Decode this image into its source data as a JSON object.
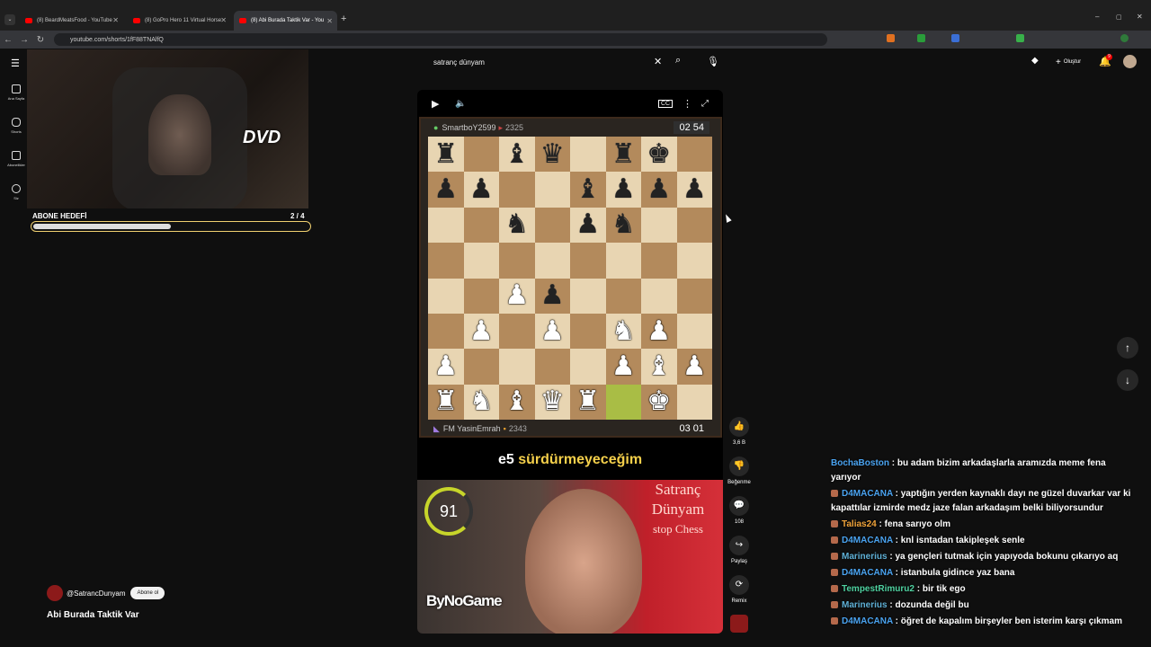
{
  "browser": {
    "tabs": [
      {
        "title": "(8) BeardMeatsFood - YouTube",
        "active": false
      },
      {
        "title": "(8) GoPro Hero 11 Virtual Horse",
        "active": false
      },
      {
        "title": "(8) Abi Burada Taktik Var - You",
        "active": true
      }
    ],
    "new_tab": "+",
    "url": "youtube.com/shorts/1fF88TNAlfQ"
  },
  "yt_sidebar": {
    "items": [
      {
        "label": "Ana Sayfa",
        "icon": "home-icon"
      },
      {
        "label": "Shorts",
        "icon": "shorts-icon"
      },
      {
        "label": "Abonelikler",
        "icon": "subscriptions-icon"
      },
      {
        "label": "Siz",
        "icon": "you-icon"
      }
    ]
  },
  "overlay": {
    "dvd_logo": "DVD",
    "goal_label": "ABONE HEDEFİ",
    "goal_count": "2 / 4",
    "goal_progress": 0.5
  },
  "search": {
    "value": "satranç dünyam"
  },
  "header": {
    "create_label": "Oluştur",
    "notif_count": "9"
  },
  "chess": {
    "top_player": "SmartboY2599",
    "top_rating": "2325",
    "top_clock": "02 54",
    "bottom_player": "FM YasinEmrah",
    "bottom_rating": "2343",
    "bottom_clock": "03 01",
    "board": [
      [
        "r",
        "",
        "b",
        "q",
        "",
        "r",
        "k",
        ""
      ],
      [
        "p",
        "p",
        "",
        "",
        "b",
        "p",
        "p",
        "p"
      ],
      [
        "",
        "",
        "n",
        "",
        "p",
        "n",
        "",
        ""
      ],
      [
        "",
        "",
        "",
        "",
        "",
        "",
        "",
        ""
      ],
      [
        "",
        "",
        "P",
        "p",
        "",
        "",
        "",
        ""
      ],
      [
        "",
        "P",
        "",
        "P",
        "",
        "N",
        "P",
        ""
      ],
      [
        "P",
        "",
        "",
        "",
        "",
        "P",
        "B",
        "P"
      ],
      [
        "R",
        "N",
        "B",
        "Q",
        "R",
        "",
        "K",
        ""
      ]
    ]
  },
  "caption": {
    "main": "e5",
    "highlight": "sürdürmeyeceğim"
  },
  "facecam": {
    "gauge_value": "91",
    "bg_title": "Satranç Dünyam",
    "bg_sub": "stop Chess",
    "brand": "ByNoGame"
  },
  "actions": {
    "like_count": "3,6 B",
    "dislike_label": "Beğenme",
    "comment_count": "108",
    "share_label": "Paylaş",
    "remix_label": "Remix"
  },
  "channel": {
    "handle": "@SatrancDunyam",
    "subscribe_label": "Abone ol",
    "title": "Abi Burada Taktik Var"
  },
  "chat": [
    {
      "user": "BochaBoston",
      "color": "#4aa3f0",
      "text": ": bu adam bizim arkadaşlarla aramızda meme fena yarıyor"
    },
    {
      "user": "D4MACANA",
      "color": "#4aa3f0",
      "text": ": yaptığın yerden kaynaklı dayı ne güzel duvarkar var ki kapattılar izmirde medz jaze falan arkadaşım belki biliyorsundur"
    },
    {
      "user": "Talias24",
      "color": "#f0a33a",
      "text": ": fena sarıyo olm"
    },
    {
      "user": "D4MACANA",
      "color": "#4aa3f0",
      "text": ": knl isntadan takipleşek senle"
    },
    {
      "user": "Marinerius",
      "color": "#5fb0d6",
      "text": ": ya gençleri tutmak için yapıyoda bokunu çıkarıyo aq"
    },
    {
      "user": "D4MACANA",
      "color": "#4aa3f0",
      "text": ": istanbula gidince yaz bana"
    },
    {
      "user": "TempestRimuru2",
      "color": "#4fd1a0",
      "text": ": bir tik ego"
    },
    {
      "user": "Marinerius",
      "color": "#5fb0d6",
      "text": ": dozunda değil bu"
    },
    {
      "user": "D4MACANA",
      "color": "#4aa3f0",
      "text": ": öğret de kapalım birşeyler ben isterim karşı çıkmam"
    }
  ]
}
